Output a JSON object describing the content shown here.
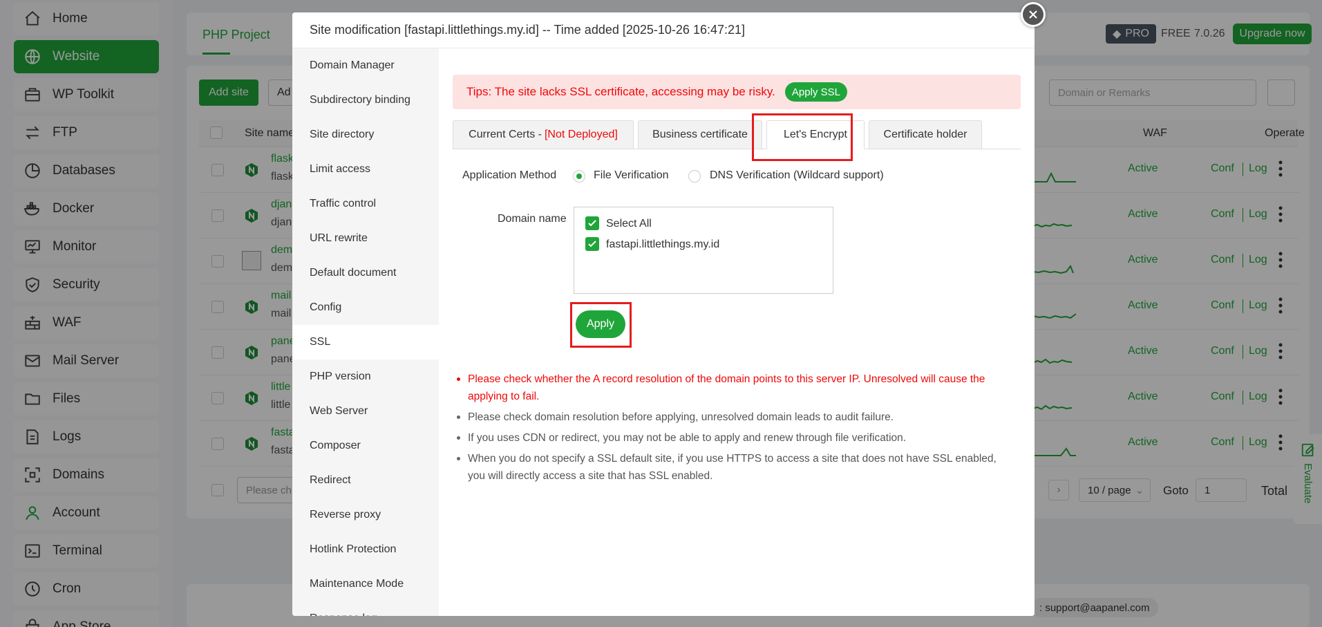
{
  "sidebar": {
    "items": [
      {
        "label": "Home",
        "icon": "home-icon"
      },
      {
        "label": "Website",
        "icon": "globe-icon",
        "active": true
      },
      {
        "label": "WP Toolkit",
        "icon": "toolkit-icon"
      },
      {
        "label": "FTP",
        "icon": "transfer-icon"
      },
      {
        "label": "Databases",
        "icon": "database-icon"
      },
      {
        "label": "Docker",
        "icon": "docker-icon"
      },
      {
        "label": "Monitor",
        "icon": "monitor-icon"
      },
      {
        "label": "Security",
        "icon": "shield-icon"
      },
      {
        "label": "WAF",
        "icon": "firewall-icon"
      },
      {
        "label": "Mail Server",
        "icon": "mail-icon"
      },
      {
        "label": "Files",
        "icon": "folder-icon"
      },
      {
        "label": "Logs",
        "icon": "log-icon"
      },
      {
        "label": "Domains",
        "icon": "domain-icon"
      },
      {
        "label": "Account",
        "icon": "user-icon"
      },
      {
        "label": "Terminal",
        "icon": "terminal-icon"
      },
      {
        "label": "Cron",
        "icon": "clock-icon"
      },
      {
        "label": "App Store",
        "icon": "store-icon"
      }
    ]
  },
  "header": {
    "project_tab": "PHP Project",
    "pro_badge": "PRO",
    "free_label": "FREE",
    "version": "7.0.26",
    "upgrade_label": "Upgrade now"
  },
  "toolbar": {
    "add_site_label": "Add site",
    "add_more_label": "Ad",
    "search_placeholder": "Domain or Remarks"
  },
  "table": {
    "site_name_header": "Site name",
    "waf_header": "WAF",
    "operate_header": "Operate",
    "rows": [
      {
        "name": "flask",
        "remark": "flask",
        "status": "Active",
        "conf": "Conf",
        "log": "Log"
      },
      {
        "name": "djan",
        "remark": "djan",
        "status": "Active",
        "conf": "Conf",
        "log": "Log"
      },
      {
        "name": "dem",
        "remark": "dem",
        "status": "Active",
        "conf": "Conf",
        "log": "Log"
      },
      {
        "name": "mail.",
        "remark": "mail",
        "status": "Active",
        "conf": "Conf",
        "log": "Log"
      },
      {
        "name": "pane",
        "remark": "pane",
        "status": "Active",
        "conf": "Conf",
        "log": "Log"
      },
      {
        "name": "little",
        "remark": "little",
        "status": "Active",
        "conf": "Conf",
        "log": "Log"
      },
      {
        "name": "fasta",
        "remark": "fasta",
        "status": "Active",
        "conf": "Conf",
        "log": "Log"
      }
    ],
    "batch_placeholder": "Please ch",
    "page_size": "10 / page",
    "goto_label": "Goto",
    "goto_value": "1",
    "total_label": "Total"
  },
  "footer": {
    "support_text": ": support@aapanel.com"
  },
  "evaluate_label": "Evaluate",
  "modal": {
    "title": "Site modification [fastapi.littlethings.my.id] -- Time added [2025-10-26 16:47:21]",
    "menu": [
      {
        "label": "Domain Manager"
      },
      {
        "label": "Subdirectory binding"
      },
      {
        "label": "Site directory"
      },
      {
        "label": "Limit access"
      },
      {
        "label": "Traffic control"
      },
      {
        "label": "URL rewrite"
      },
      {
        "label": "Default document"
      },
      {
        "label": "Config"
      },
      {
        "label": "SSL",
        "active": true
      },
      {
        "label": "PHP version"
      },
      {
        "label": "Web Server"
      },
      {
        "label": "Composer"
      },
      {
        "label": "Redirect"
      },
      {
        "label": "Reverse proxy"
      },
      {
        "label": "Hotlink Protection"
      },
      {
        "label": "Maintenance Mode"
      },
      {
        "label": "Response log"
      }
    ],
    "tips": {
      "text": "Tips: The site lacks SSL certificate, accessing may be risky.",
      "button": "Apply SSL"
    },
    "tabs": {
      "current_certs": "Current Certs - ",
      "not_deployed": "[Not Deployed]",
      "business": "Business certificate",
      "letsencrypt": "Let's Encrypt",
      "holder": "Certificate holder"
    },
    "form": {
      "method_label": "Application Method",
      "file_verification": "File Verification",
      "dns_verification": "DNS Verification (Wildcard support)",
      "domain_label": "Domain name",
      "select_all": "Select All",
      "domain": "fastapi.littlethings.my.id",
      "apply_label": "Apply"
    },
    "notes": [
      "Please check whether the A record resolution of the domain points to this server IP. Unresolved will cause the applying to fail.",
      "Please check domain resolution before applying, unresolved domain leads to audit failure.",
      "If you uses CDN or redirect, you may not be able to apply and renew through file verification.",
      "When you do not specify a SSL default site, if you use HTTPS to access a site that does not have SSL enabled, you will directly access a site that has SSL enabled."
    ]
  },
  "colors": {
    "brand_green": "#20a53a",
    "warning_red": "#ef0808",
    "highlight_red": "#e51c1c"
  }
}
